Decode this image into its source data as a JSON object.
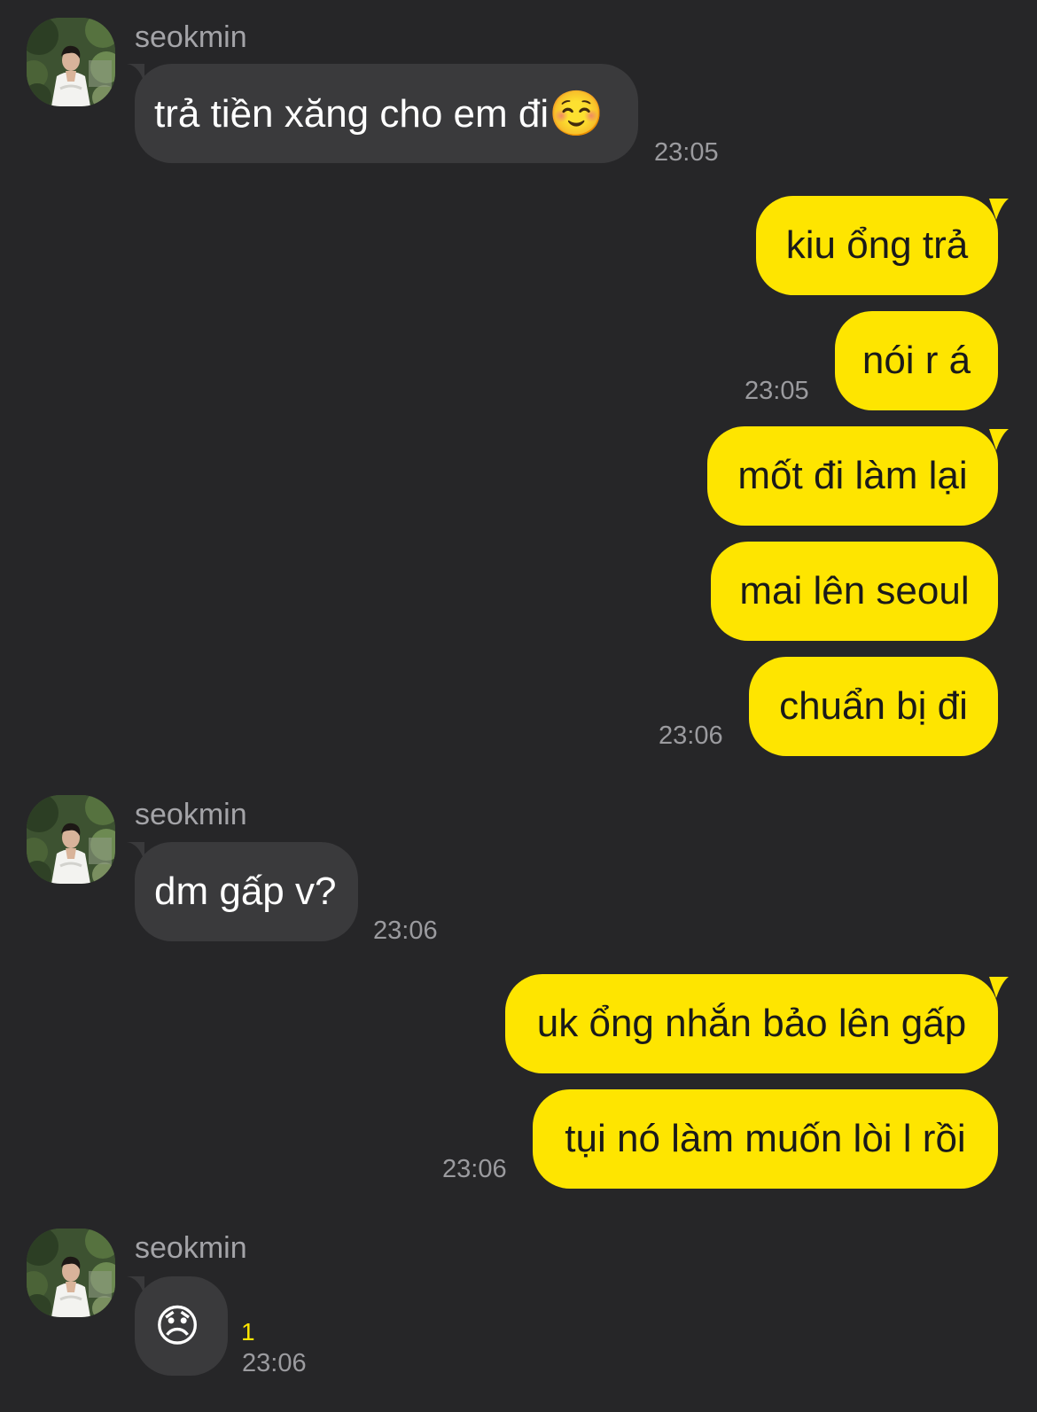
{
  "colors": {
    "background": "#262628",
    "incoming_bubble": "#3a3a3c",
    "outgoing_bubble": "#fee500",
    "unread_count": "#fee500"
  },
  "messages": [
    {
      "sender": "seokmin",
      "text": "trả tiền xăng cho em đi",
      "emoji": "☺️",
      "time": "23:05"
    },
    {
      "text": "kiu ổng trả"
    },
    {
      "text": "nói r á",
      "time": "23:05"
    },
    {
      "text": "mốt đi làm lại"
    },
    {
      "text": "mai lên seoul"
    },
    {
      "text": "chuẩn bị đi",
      "time": "23:06"
    },
    {
      "sender": "seokmin",
      "text": "dm gấp v?",
      "time": "23:06"
    },
    {
      "text": "uk ổng nhắn bảo lên gấp"
    },
    {
      "text": "tụi nó làm muốn lòi l rồi",
      "time": "23:06"
    },
    {
      "sender": "seokmin",
      "emoji": "😞",
      "unread": "1",
      "time": "23:06"
    }
  ]
}
